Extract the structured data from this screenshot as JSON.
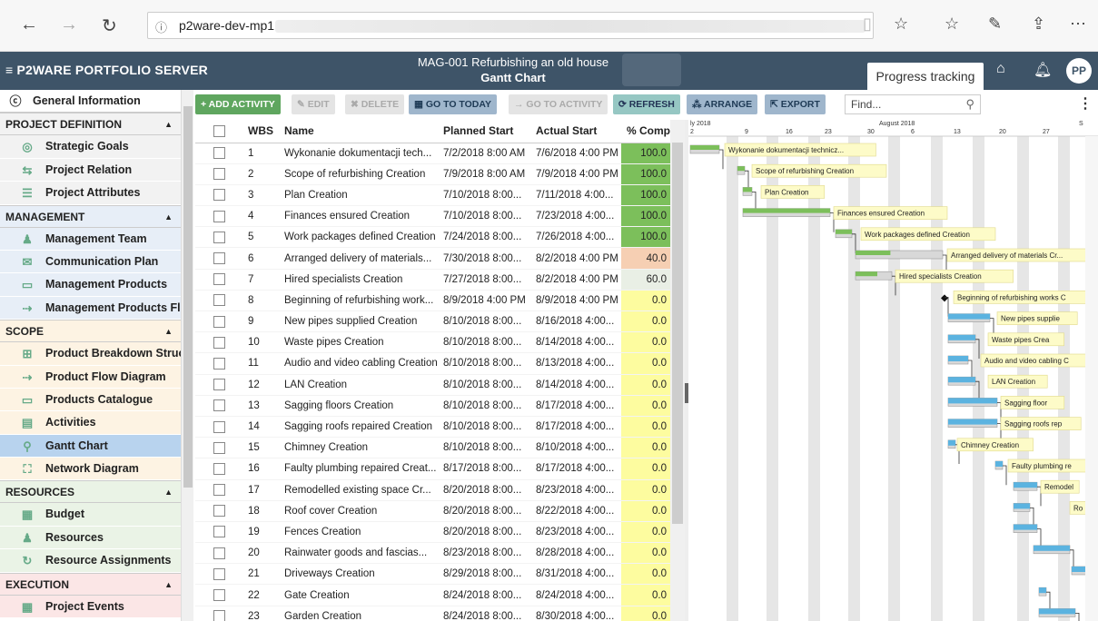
{
  "browser": {
    "url_text": "p2ware-dev-mp1",
    "icons": [
      "back-icon",
      "forward-icon",
      "refresh-icon",
      "info-icon",
      "reading-view-icon",
      "favorite-star-icon",
      "favorites-list-icon",
      "pen-icon",
      "share-icon",
      "more-icon"
    ]
  },
  "app": {
    "logo": "≡ P2WARE PORTFOLIO SERVER",
    "title_line1": "MAG-001 Refurbishing an old house",
    "title_line2": "Gantt Chart",
    "active_tab": "Progress tracking",
    "avatar": "PP"
  },
  "sidebar": {
    "general": "General Information",
    "sections": [
      {
        "title": "PROJECT DEFINITION",
        "items": [
          "Strategic Goals",
          "Project Relation",
          "Project Attributes"
        ]
      },
      {
        "title": "MANAGEMENT",
        "items": [
          "Management Team",
          "Communication Plan",
          "Management Products",
          "Management Products Fl"
        ]
      },
      {
        "title": "SCOPE",
        "items": [
          "Product Breakdown Struc",
          "Product Flow Diagram",
          "Products Catalogue",
          "Activities",
          "Gantt Chart",
          "Network Diagram"
        ]
      },
      {
        "title": "RESOURCES",
        "items": [
          "Budget",
          "Resources",
          "Resource Assignments"
        ]
      },
      {
        "title": "EXECUTION",
        "items": [
          "Project Events"
        ]
      }
    ],
    "active_item": "Gantt Chart"
  },
  "toolbar": {
    "add": "+ ADD ACTIVITY",
    "edit": "✎ EDIT",
    "delete": "✖ DELETE",
    "today": "▦ GO TO TODAY",
    "goto_activity": "→ GO TO ACTIVITY",
    "refresh": "⟳ REFRESH",
    "arrange": "⁂ ARRANGE",
    "export": "⇱ EXPORT",
    "find_placeholder": "Find..."
  },
  "grid": {
    "columns": [
      "",
      "WBS",
      "Name",
      "Planned Start",
      "Actual Start",
      "% Comp"
    ],
    "rows": [
      [
        "1",
        "Wykonanie dokumentacji tech...",
        "7/2/2018 8:00 AM",
        "7/6/2018 4:00 PM",
        "100.0"
      ],
      [
        "2",
        "Scope of refurbishing Creation",
        "7/9/2018 8:00 AM",
        "7/9/2018 4:00 PM",
        "100.0"
      ],
      [
        "3",
        "Plan Creation",
        "7/10/2018 8:00...",
        "7/11/2018 4:00...",
        "100.0"
      ],
      [
        "4",
        "Finances ensured Creation",
        "7/10/2018 8:00...",
        "7/23/2018 4:00...",
        "100.0"
      ],
      [
        "5",
        "Work packages defined Creation",
        "7/24/2018 8:00...",
        "7/26/2018 4:00...",
        "100.0"
      ],
      [
        "6",
        "Arranged delivery of materials...",
        "7/30/2018 8:00...",
        "8/2/2018 4:00 PM",
        "40.0"
      ],
      [
        "7",
        "Hired specialists Creation",
        "7/27/2018 8:00...",
        "8/2/2018 4:00 PM",
        "60.0"
      ],
      [
        "8",
        "Beginning of refurbishing work...",
        "8/9/2018 4:00 PM",
        "8/9/2018 4:00 PM",
        "0.0"
      ],
      [
        "9",
        "New pipes supplied Creation",
        "8/10/2018 8:00...",
        "8/16/2018 4:00...",
        "0.0"
      ],
      [
        "10",
        "Waste pipes Creation",
        "8/10/2018 8:00...",
        "8/14/2018 4:00...",
        "0.0"
      ],
      [
        "11",
        "Audio and video cabling Creation",
        "8/10/2018 8:00...",
        "8/13/2018 4:00...",
        "0.0"
      ],
      [
        "12",
        "LAN Creation",
        "8/10/2018 8:00...",
        "8/14/2018 4:00...",
        "0.0"
      ],
      [
        "13",
        "Sagging floors Creation",
        "8/10/2018 8:00...",
        "8/17/2018 4:00...",
        "0.0"
      ],
      [
        "14",
        "Sagging roofs repaired Creation",
        "8/10/2018 8:00...",
        "8/17/2018 4:00...",
        "0.0"
      ],
      [
        "15",
        "Chimney Creation",
        "8/10/2018 8:00...",
        "8/10/2018 4:00...",
        "0.0"
      ],
      [
        "16",
        "Faulty plumbing repaired Creat...",
        "8/17/2018 8:00...",
        "8/17/2018 4:00...",
        "0.0"
      ],
      [
        "17",
        "Remodelled existing space Cr...",
        "8/20/2018 8:00...",
        "8/23/2018 4:00...",
        "0.0"
      ],
      [
        "18",
        "Roof cover Creation",
        "8/20/2018 8:00...",
        "8/22/2018 4:00...",
        "0.0"
      ],
      [
        "19",
        "Fences Creation",
        "8/20/2018 8:00...",
        "8/23/2018 4:00...",
        "0.0"
      ],
      [
        "20",
        "Rainwater goods and fascias...",
        "8/23/2018 8:00...",
        "8/28/2018 4:00...",
        "0.0"
      ],
      [
        "21",
        "Driveways Creation",
        "8/29/2018 8:00...",
        "8/31/2018 4:00...",
        "0.0"
      ],
      [
        "22",
        "Gate Creation",
        "8/24/2018 8:00...",
        "8/24/2018 4:00...",
        "0.0"
      ],
      [
        "23",
        "Garden Creation",
        "8/24/2018 8:00...",
        "8/30/2018 4:00...",
        "0.0"
      ]
    ]
  },
  "gantt": {
    "month_labels": [
      "ly 2018",
      "August 2018",
      "S"
    ],
    "day_labels": [
      "2",
      "9",
      "16",
      "23",
      "30",
      "6",
      "13",
      "20",
      "27"
    ],
    "bar_labels": [
      "Wykonanie dokumentacji technicz...",
      "Scope of refurbishing Creation",
      "Plan Creation",
      "Finances ensured Creation",
      "Work packages defined Creation",
      "Arranged delivery of materials Cr...",
      "Hired specialists Creation",
      "Beginning of refurbishing works C",
      "New pipes supplie",
      "Waste pipes Crea",
      "Audio and video cabling C",
      "LAN Creation",
      "Sagging floor",
      "Sagging roofs rep",
      "Chimney Creation",
      "Faulty plumbing re",
      "Remodel",
      "Ro"
    ]
  },
  "colors": {
    "header_bg": "#3e5468",
    "pct_complete": "#7cbf5b",
    "pct_partial": "#f6cfb3",
    "pct_zero": "#fdfc9f",
    "bar_done": "#7cbf5b",
    "bar_todo": "#5bb3e0"
  }
}
